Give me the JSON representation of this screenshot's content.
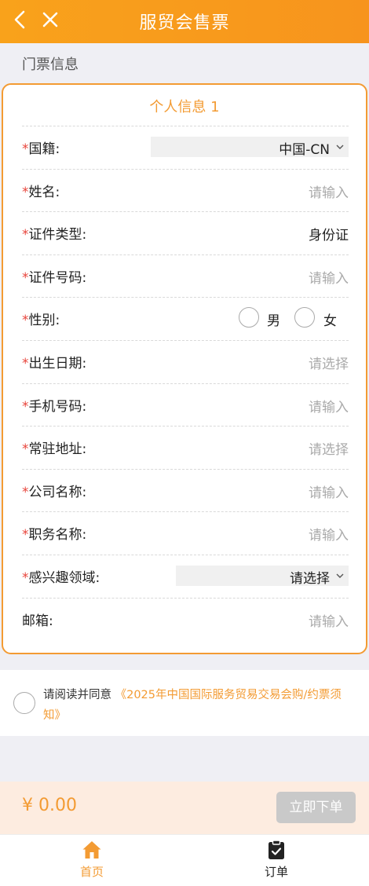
{
  "header": {
    "title": "服贸会售票"
  },
  "section_label": "门票信息",
  "card": {
    "title": "个人信息 1",
    "fields": [
      {
        "label": "国籍:",
        "required": true,
        "kind": "select",
        "value": "中国-CN"
      },
      {
        "label": "姓名:",
        "required": true,
        "kind": "input",
        "placeholder": "请输入"
      },
      {
        "label": "证件类型:",
        "required": true,
        "kind": "value",
        "value": "身份证"
      },
      {
        "label": "证件号码:",
        "required": true,
        "kind": "input",
        "placeholder": "请输入"
      },
      {
        "label": "性别:",
        "required": true,
        "kind": "radio",
        "options": [
          "男",
          "女"
        ]
      },
      {
        "label": "出生日期:",
        "required": true,
        "kind": "picker",
        "placeholder": "请选择"
      },
      {
        "label": "手机号码:",
        "required": true,
        "kind": "input",
        "placeholder": "请输入"
      },
      {
        "label": "常驻地址:",
        "required": true,
        "kind": "picker",
        "placeholder": "请选择"
      },
      {
        "label": "公司名称:",
        "required": true,
        "kind": "input",
        "placeholder": "请输入"
      },
      {
        "label": "职务名称:",
        "required": true,
        "kind": "input",
        "placeholder": "请输入"
      },
      {
        "label": "感兴趣领域:",
        "required": true,
        "kind": "select",
        "value": "请选择"
      },
      {
        "label": "邮箱:",
        "required": false,
        "kind": "input",
        "placeholder": "请输入"
      }
    ]
  },
  "agreement": {
    "prefix": "请阅读并同意 ",
    "link": "《2025年中国国际服务贸易交易会购/约票须知》"
  },
  "pay": {
    "price": "¥ 0.00",
    "button": "立即下单"
  },
  "tabbar": {
    "home": "首页",
    "orders": "订单"
  },
  "colors": {
    "accent": "#f39b33",
    "required": "#e8453c",
    "disabled_button": "#c9c9c9"
  },
  "icons": {
    "back": "chevron-left-icon",
    "close": "close-icon",
    "home": "home-icon",
    "orders": "clipboard-check-icon"
  }
}
